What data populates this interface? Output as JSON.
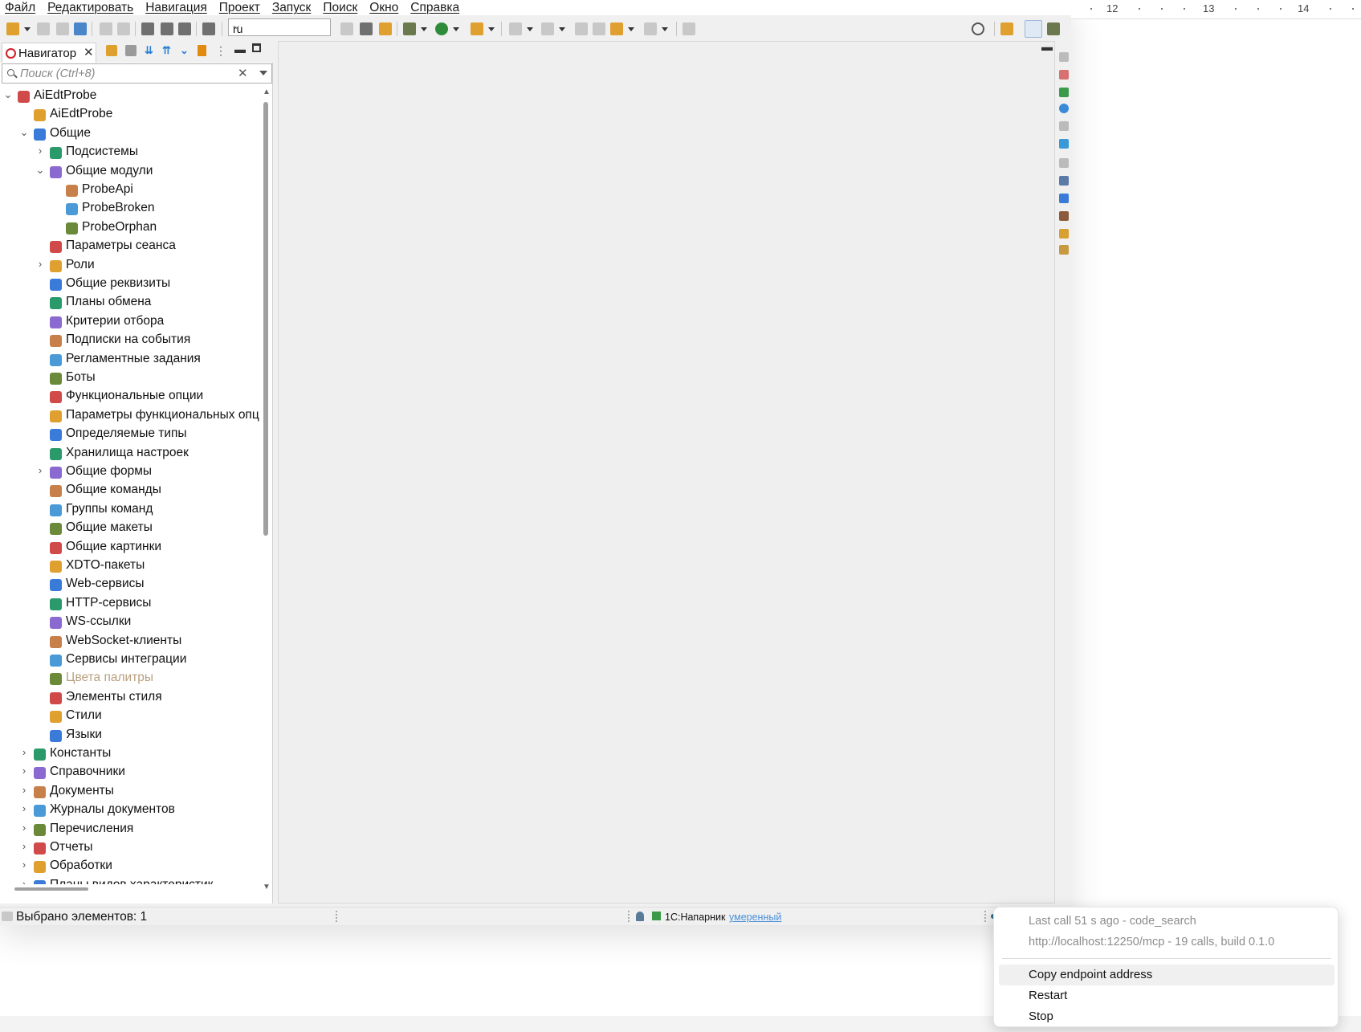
{
  "menubar": {
    "items": [
      "Файл",
      "Редактировать",
      "Навигация",
      "Проект",
      "Запуск",
      "Поиск",
      "Окно",
      "Справка"
    ]
  },
  "toolbar": {
    "language_combo": "ru",
    "icons": [
      "new-icon",
      "save-icon",
      "save-all-icon",
      "print-icon",
      "undo-icon",
      "redo-icon",
      "debug-icon",
      "run-icon",
      "search-icon",
      "1c-perspective-icon"
    ]
  },
  "navigator": {
    "tab_title": "Навигатор",
    "search_placeholder": "Поиск (Ctrl+8)",
    "tree": [
      {
        "label": "AiEdtProbe",
        "level": 0,
        "twisty": "open",
        "icon": "configuration-icon"
      },
      {
        "label": "AiEdtProbe",
        "level": 1,
        "twisty": "none",
        "icon": "configuration-root-icon"
      },
      {
        "label": "Общие",
        "level": 1,
        "twisty": "open",
        "icon": "common-icon"
      },
      {
        "label": "Подсистемы",
        "level": 2,
        "twisty": "closed",
        "icon": "subsystems-icon"
      },
      {
        "label": "Общие модули",
        "level": 2,
        "twisty": "open",
        "icon": "common-modules-icon"
      },
      {
        "label": "ProbeApi",
        "level": 3,
        "twisty": "none",
        "icon": "module-icon"
      },
      {
        "label": "ProbeBroken",
        "level": 3,
        "twisty": "none",
        "icon": "module-error-icon"
      },
      {
        "label": "ProbeOrphan",
        "level": 3,
        "twisty": "none",
        "icon": "module-icon"
      },
      {
        "label": "Параметры сеанса",
        "level": 2,
        "twisty": "none",
        "icon": "session-params-icon"
      },
      {
        "label": "Роли",
        "level": 2,
        "twisty": "closed",
        "icon": "roles-icon"
      },
      {
        "label": "Общие реквизиты",
        "level": 2,
        "twisty": "none",
        "icon": "common-attributes-icon"
      },
      {
        "label": "Планы обмена",
        "level": 2,
        "twisty": "none",
        "icon": "exchange-plans-icon"
      },
      {
        "label": "Критерии отбора",
        "level": 2,
        "twisty": "none",
        "icon": "filter-criteria-icon"
      },
      {
        "label": "Подписки на события",
        "level": 2,
        "twisty": "none",
        "icon": "event-subscriptions-icon"
      },
      {
        "label": "Регламентные задания",
        "level": 2,
        "twisty": "none",
        "icon": "scheduled-jobs-icon"
      },
      {
        "label": "Боты",
        "level": 2,
        "twisty": "none",
        "icon": "bots-icon"
      },
      {
        "label": "Функциональные опции",
        "level": 2,
        "twisty": "none",
        "icon": "functional-options-icon"
      },
      {
        "label": "Параметры функциональных опц",
        "level": 2,
        "twisty": "none",
        "icon": "functional-options-params-icon"
      },
      {
        "label": "Определяемые типы",
        "level": 2,
        "twisty": "none",
        "icon": "defined-types-icon"
      },
      {
        "label": "Хранилища настроек",
        "level": 2,
        "twisty": "none",
        "icon": "settings-storages-icon"
      },
      {
        "label": "Общие формы",
        "level": 2,
        "twisty": "closed",
        "icon": "common-forms-icon"
      },
      {
        "label": "Общие команды",
        "level": 2,
        "twisty": "none",
        "icon": "common-commands-icon"
      },
      {
        "label": "Группы команд",
        "level": 2,
        "twisty": "none",
        "icon": "command-groups-icon"
      },
      {
        "label": "Общие макеты",
        "level": 2,
        "twisty": "none",
        "icon": "common-templates-icon"
      },
      {
        "label": "Общие картинки",
        "level": 2,
        "twisty": "none",
        "icon": "common-pictures-icon"
      },
      {
        "label": "XDTO-пакеты",
        "level": 2,
        "twisty": "none",
        "icon": "xdto-packages-icon"
      },
      {
        "label": "Web-сервисы",
        "level": 2,
        "twisty": "none",
        "icon": "web-services-icon"
      },
      {
        "label": "HTTP-сервисы",
        "level": 2,
        "twisty": "none",
        "icon": "http-services-icon"
      },
      {
        "label": "WS-ссылки",
        "level": 2,
        "twisty": "none",
        "icon": "ws-references-icon"
      },
      {
        "label": "WebSocket-клиенты",
        "level": 2,
        "twisty": "none",
        "icon": "websocket-clients-icon"
      },
      {
        "label": "Сервисы интеграции",
        "level": 2,
        "twisty": "none",
        "icon": "integration-services-icon"
      },
      {
        "label": "Цвета палитры",
        "level": 2,
        "twisty": "none",
        "icon": "palette-colors-icon",
        "dim": true
      },
      {
        "label": "Элементы стиля",
        "level": 2,
        "twisty": "none",
        "icon": "style-items-icon"
      },
      {
        "label": "Стили",
        "level": 2,
        "twisty": "none",
        "icon": "styles-icon"
      },
      {
        "label": "Языки",
        "level": 2,
        "twisty": "none",
        "icon": "languages-icon"
      },
      {
        "label": "Константы",
        "level": 1,
        "twisty": "closed",
        "icon": "constants-icon"
      },
      {
        "label": "Справочники",
        "level": 1,
        "twisty": "closed",
        "icon": "catalogs-icon"
      },
      {
        "label": "Документы",
        "level": 1,
        "twisty": "closed",
        "icon": "documents-icon"
      },
      {
        "label": "Журналы документов",
        "level": 1,
        "twisty": "closed",
        "icon": "document-journals-icon"
      },
      {
        "label": "Перечисления",
        "level": 1,
        "twisty": "closed",
        "icon": "enums-icon"
      },
      {
        "label": "Отчеты",
        "level": 1,
        "twisty": "closed",
        "icon": "reports-icon"
      },
      {
        "label": "Обработки",
        "level": 1,
        "twisty": "closed",
        "icon": "data-processors-icon"
      },
      {
        "label": "Планы видов характеристик",
        "level": 1,
        "twisty": "closed",
        "icon": "chart-of-characteristic-types-icon"
      }
    ]
  },
  "statusbar": {
    "selection_text": "Выбрано элементов: 1",
    "assistant_label": "1С:Напарник",
    "assistant_mode_link": "умеренный"
  },
  "ruler": {
    "numbers": [
      "12",
      "13",
      "14"
    ]
  },
  "popup": {
    "last_call": "Last call 51 s ago - code_search",
    "endpoint_info": "http://localhost:12250/mcp - 19 calls, build 0.1.0",
    "items": [
      "Copy endpoint address",
      "Restart",
      "Stop"
    ]
  },
  "colors": {
    "accent_red": "#d0202a",
    "link_blue": "#4a90d9",
    "status_green": "#3a9a4a",
    "popup_hover": "#f0f0f0"
  }
}
